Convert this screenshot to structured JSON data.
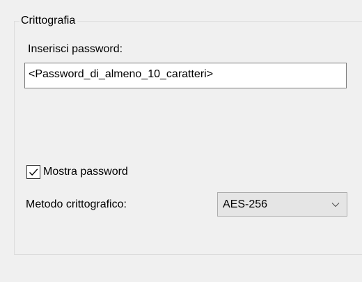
{
  "group": {
    "title": "Crittografia"
  },
  "password": {
    "label": "Inserisci password:",
    "value": "<Password_di_almeno_10_caratteri>"
  },
  "show_password": {
    "label": "Mostra password",
    "checked": true
  },
  "encryption_method": {
    "label": "Metodo crittografico:",
    "selected": "AES-256"
  },
  "icons": {
    "checkbox_mark": "checkmark-icon",
    "combo_arrow": "chevron-down-icon"
  },
  "colors": {
    "background": "#f0f0f0",
    "input_border": "#7a7a7a",
    "combo_background": "#e5e5e5"
  }
}
